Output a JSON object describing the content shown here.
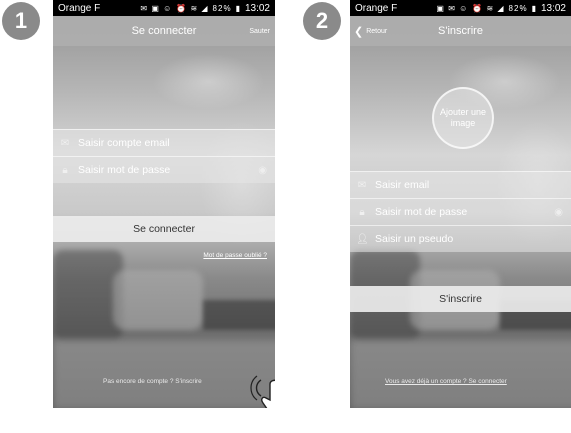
{
  "steps": [
    "1",
    "2"
  ],
  "status_bar": {
    "carrier": "Orange F",
    "battery": "82%",
    "time": "13:02",
    "icons": [
      "message-icon",
      "image-icon",
      "whatsapp-icon",
      "alarm-icon",
      "wifi-icon",
      "signal-icon",
      "battery-icon"
    ]
  },
  "login": {
    "title": "Se connecter",
    "skip_label": "Sauter",
    "email_placeholder": "Saisir compte email",
    "password_placeholder": "Saisir mot de passe",
    "submit_label": "Se connecter",
    "forgot_label": "Mot de passe oublié ?",
    "no_account_label": "Pas encore de compte ? S'inscrire"
  },
  "signup": {
    "back_label": "Retour",
    "title": "S'inscrire",
    "avatar_label": "Ajouter une image",
    "email_placeholder": "Saisir email",
    "password_placeholder": "Saisir mot de passe",
    "pseudo_placeholder": "Saisir un pseudo",
    "submit_label": "S'inscrire",
    "have_account_label": "Vous avez déjà un compte ? Se connecter"
  },
  "colors": {
    "bar": "#afafaf",
    "button": "#ececec",
    "step": "#8a8a8a"
  }
}
